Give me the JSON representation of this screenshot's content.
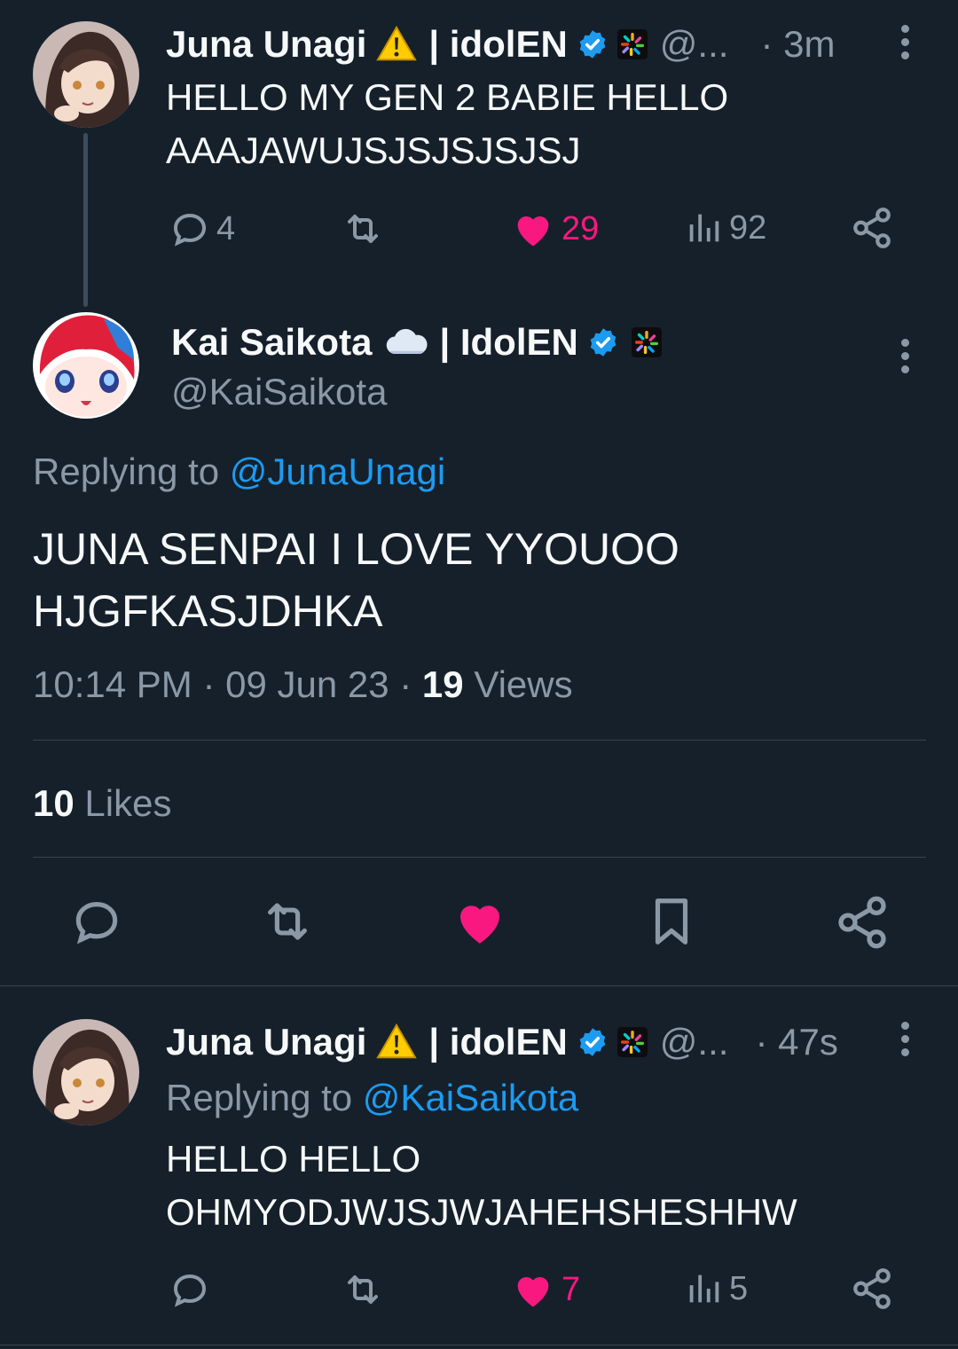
{
  "tweets": [
    {
      "name": "Juna Unagi",
      "warning_emoji": "⚠️",
      "affiliation": "| idolEN",
      "handle": "@...",
      "time": "· 3m",
      "text": "HELLO MY GEN 2 BABIE HELLO\nAAAJAWUJSJSJSJSJSJ",
      "replies": "4",
      "likes": "29",
      "views": "92"
    },
    {
      "name": "Kai Saikota",
      "affiliation": "| IdolEN",
      "handle": "@KaiSaikota",
      "replying_prefix": "Replying to",
      "replying_handle": "@JunaUnagi",
      "text": "JUNA SENPAI I LOVE YYOUOO\nHJGFKASJDHKA",
      "timestamp": "10:14 PM · 09 Jun 23 ·",
      "views_count": "19",
      "views_label": "Views",
      "likes_count": "10",
      "likes_label": "Likes"
    },
    {
      "name": "Juna Unagi",
      "warning_emoji": "⚠️",
      "affiliation": "| idolEN",
      "handle": "@...",
      "time": "· 47s",
      "replying_prefix": "Replying to",
      "replying_handle": "@KaiSaikota",
      "text": "HELLO HELLO\nOHMYODJWJSJWJAHEHSHESHHW",
      "likes": "7",
      "views": "5"
    }
  ],
  "colors": {
    "background": "#15202b",
    "like": "#f91880",
    "link": "#1d9bf0",
    "verified": "#1d9bf0",
    "muted": "#8b98a5"
  }
}
